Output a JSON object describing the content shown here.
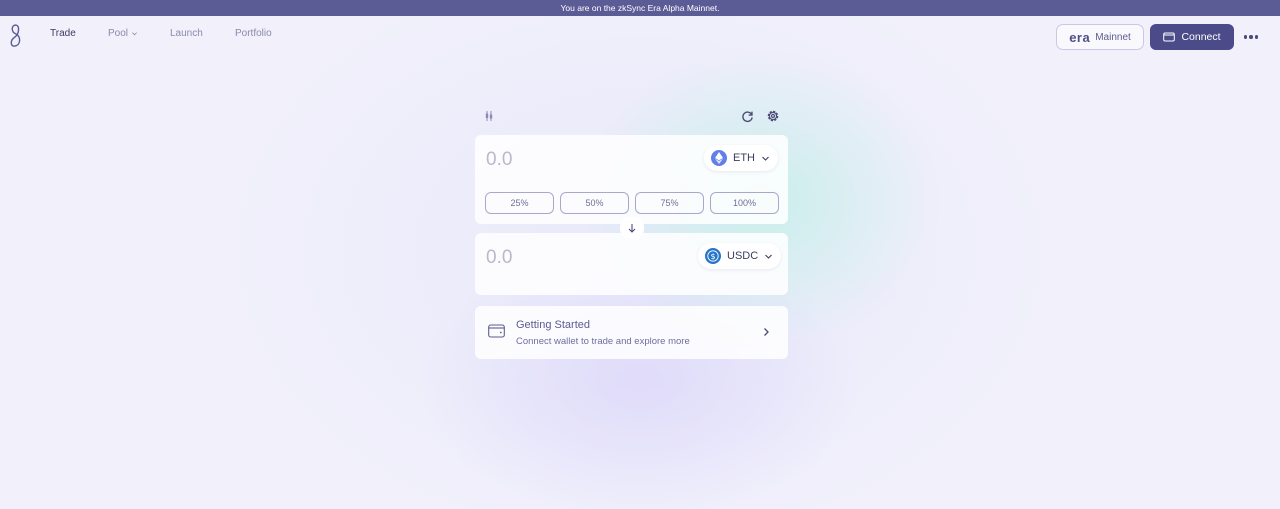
{
  "banner": {
    "text": "You are on the zkSync Era Alpha Mainnet."
  },
  "nav": {
    "logo_icon": "matter-labs-logo-icon",
    "links": [
      {
        "label": "Trade",
        "active": true
      },
      {
        "label": "Pool",
        "has_dropdown": true
      },
      {
        "label": "Launch"
      },
      {
        "label": "Portfolio"
      }
    ],
    "network": {
      "logo_text": "era",
      "label": "Mainnet"
    },
    "connect_label": "Connect",
    "more_icon": "more-dots-icon"
  },
  "swap": {
    "toolbar_icons": [
      "chart-candles-icon",
      "refresh-icon",
      "settings-gear-icon"
    ],
    "from": {
      "amount": "0.0",
      "token": "ETH",
      "token_icon": "ethereum-icon",
      "percentages": [
        "25%",
        "50%",
        "75%",
        "100%"
      ]
    },
    "switch_icon": "arrow-down-icon",
    "to": {
      "amount": "0.0",
      "token": "USDC",
      "token_icon": "usdc-icon"
    }
  },
  "getting_started": {
    "icon": "wallet-icon",
    "title": "Getting Started",
    "subtitle": "Connect wallet to trade and explore more",
    "chevron": "chevron-right-icon"
  },
  "colors": {
    "background": "#f1f0fb",
    "banner": "#5b5b96",
    "accent": "#4b4b8a",
    "eth": "#627eea",
    "usdc": "#2775ca"
  }
}
